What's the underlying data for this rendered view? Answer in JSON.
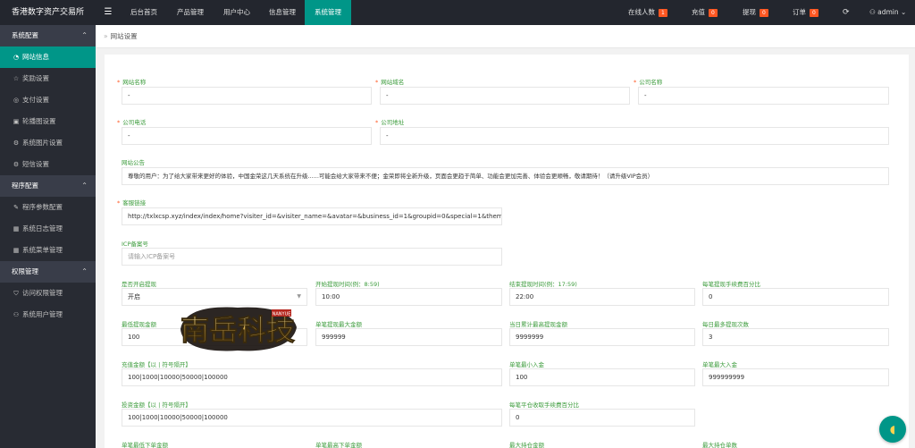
{
  "app": {
    "title": "香港数字资产交易所"
  },
  "topnav": {
    "items": [
      {
        "label": "后台首页",
        "active": false
      },
      {
        "label": "产品管理",
        "active": false
      },
      {
        "label": "用户中心",
        "active": false
      },
      {
        "label": "信息管理",
        "active": false
      },
      {
        "label": "系统管理",
        "active": true
      }
    ]
  },
  "topright": {
    "online": {
      "label": "在线人数",
      "count": "1"
    },
    "recharge": {
      "label": "充值",
      "count": "0"
    },
    "withdraw": {
      "label": "提现",
      "count": "0"
    },
    "orders": {
      "label": "订单",
      "count": "0"
    },
    "user": "admin"
  },
  "sidebar": {
    "groups": [
      {
        "label": "系统配置",
        "items": [
          {
            "label": "网站信息",
            "icon": "dashboard-icon",
            "active": true
          },
          {
            "label": "奖励设置",
            "icon": "star-icon",
            "active": false
          },
          {
            "label": "支付设置",
            "icon": "pay-icon",
            "active": false
          },
          {
            "label": "轮播图设置",
            "icon": "image-icon",
            "active": false
          },
          {
            "label": "系统图片设置",
            "icon": "gear-icon",
            "active": false
          },
          {
            "label": "短信设置",
            "icon": "gear-icon",
            "active": false
          }
        ]
      },
      {
        "label": "程序配置",
        "items": [
          {
            "label": "程序参数配置",
            "icon": "wrench-icon",
            "active": false
          },
          {
            "label": "系统日志管理",
            "icon": "calendar-icon",
            "active": false
          },
          {
            "label": "系统菜单管理",
            "icon": "calendar-icon",
            "active": false
          }
        ]
      },
      {
        "label": "权限管理",
        "items": [
          {
            "label": "访问权限管理",
            "icon": "shield-icon",
            "active": false
          },
          {
            "label": "系统用户管理",
            "icon": "user-icon",
            "active": false
          }
        ]
      }
    ]
  },
  "breadcrumb": {
    "text": "网站设置"
  },
  "form": {
    "site_name": {
      "label": "网站名称",
      "value": "-"
    },
    "site_domain": {
      "label": "网站域名",
      "value": "-"
    },
    "company_name": {
      "label": "公司名称",
      "value": "-"
    },
    "company_phone": {
      "label": "公司电话",
      "value": "-"
    },
    "company_address": {
      "label": "公司地址",
      "value": "-"
    },
    "notice": {
      "label": "网站公告",
      "value": "尊敬的用户：为了给大家带来更好的体验，中国金荣这几天系统在升级......可能会给大家带来不便；金荣即将全新升级，页面会更趋于简单、功能会更加完善、体验会更顺畅，敬请期待！（请升级VIP会员）"
    },
    "service_link": {
      "label": "客服链接",
      "value": "http://txlxcsp.xyz/index/index/home?visiter_id=&visiter_name=&avatar=&business_id=1&groupid=0&special=1&theme=7571f9"
    },
    "icp": {
      "label": "ICP备案号",
      "placeholder": "请输入ICP备案号"
    },
    "withdraw_enabled": {
      "label": "是否开启提现",
      "value": "开启"
    },
    "withdraw_start": {
      "label": "开始提现时间(例：8:59)",
      "value": "10:00"
    },
    "withdraw_end": {
      "label": "结束提现时间(例：17:59)",
      "value": "22:00"
    },
    "withdraw_fee": {
      "label": "每笔提现手续费百分比",
      "value": "0"
    },
    "withdraw_min": {
      "label": "最低提现金额",
      "value": "100"
    },
    "withdraw_max": {
      "label": "单笔提现最大金额",
      "value": "999999"
    },
    "daily_total": {
      "label": "当日累计最高提现金额",
      "value": "9999999"
    },
    "daily_times": {
      "label": "每日最多提现次数",
      "value": "3"
    },
    "recharge_amounts": {
      "label": "充值金额【以 | 符号隔开】",
      "value": "100|1000|10000|50000|100000"
    },
    "min_deposit": {
      "label": "单笔最小入金",
      "value": "100"
    },
    "max_deposit": {
      "label": "单笔最大入金",
      "value": "999999999"
    },
    "invest_amounts": {
      "label": "投资金额【以 | 符号隔开】",
      "value": "100|1000|10000|50000|100000"
    },
    "close_fee": {
      "label": "每笔平仓收取手续费百分比",
      "value": "0"
    },
    "row_labels": [
      "单笔最低下单金额",
      "单笔最高下单金额",
      "最大持仓金额",
      "最大持仓单数"
    ]
  },
  "watermark": {
    "text": "南岳科技",
    "sub": "NANYUE"
  }
}
